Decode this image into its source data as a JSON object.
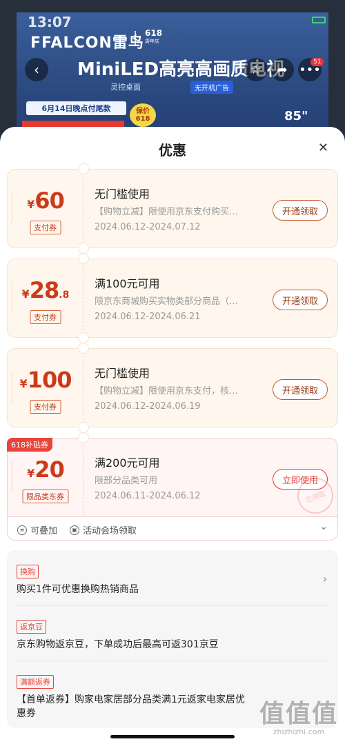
{
  "status": {
    "time": "13:07"
  },
  "product": {
    "brand": "FFALCON雷鸟",
    "brand_618": "618",
    "brand_618_sub": "周年庆",
    "headline": "MiniLED高亮高画质电视",
    "sub_line": "灵控桌面",
    "sub_tag": "无开机广告",
    "promo_date": "6月14日晚点付尾款",
    "promo_618": "保价618",
    "tv_size": "85\"",
    "more_badge": "51"
  },
  "sheet": {
    "title": "优惠",
    "close_icon": "✕"
  },
  "coupons": [
    {
      "currency": "¥",
      "amount": "60",
      "decimal": "",
      "type": "支付券",
      "title": "无门槛使用",
      "desc": "【购物立减】限使用京东支付购买…",
      "date": "2024.06.12-2024.07.12",
      "button": "开通领取"
    },
    {
      "currency": "¥",
      "amount": "28",
      "decimal": ".8",
      "type": "支付券",
      "title": "满100元可用",
      "desc": "限京东商城购买实物类部分商品（…",
      "date": "2024.06.12-2024.06.21",
      "button": "开通领取"
    },
    {
      "currency": "¥",
      "amount": "100",
      "decimal": "",
      "type": "支付券",
      "title": "无门槛使用",
      "desc": "【购物立减】限使用京东支付，核…",
      "date": "2024.06.12-2024.06.19",
      "button": "开通领取"
    },
    {
      "badge": "618补贴券",
      "currency": "¥",
      "amount": "20",
      "decimal": "",
      "type": "限品类东券",
      "title": "满200元可用",
      "desc": "限部分品类可用",
      "date": "2024.06.11-2024.06.12",
      "button": "立即使用",
      "stamp": "已领取"
    }
  ],
  "coupon_footer": {
    "stackable": "可叠加",
    "venue": "活动会场领取"
  },
  "perks": [
    {
      "tag": "换购",
      "text": "购买1件可优惠换购热销商品"
    },
    {
      "tag": "返京豆",
      "text": "京东购物返京豆，下单成功后最高可返301京豆"
    },
    {
      "tag": "满额返券",
      "text": "【首单返券】购家电家居部分品类满1元返家电家居优惠券"
    }
  ],
  "watermark": {
    "big": "值值值",
    "small": "zhizhizhi.com"
  }
}
